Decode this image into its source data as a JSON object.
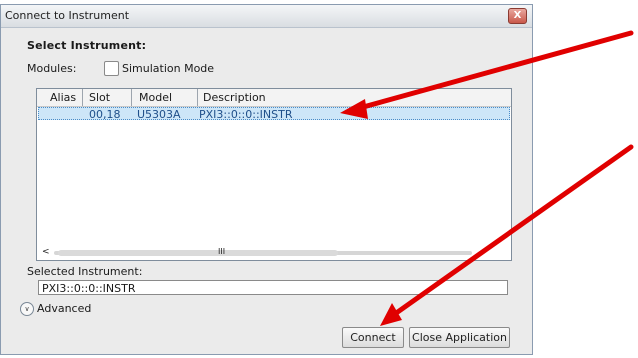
{
  "window": {
    "title": "Connect to Instrument",
    "close_glyph": "X"
  },
  "heading": "Select Instrument:",
  "modules": {
    "label": "Modules:",
    "simulation_label": "Simulation Mode",
    "simulation_checked": false
  },
  "table": {
    "columns": [
      "Alias",
      "Slot",
      "Model",
      "Description"
    ],
    "rows": [
      {
        "alias": "",
        "slot": "00,18",
        "model": "U5303A",
        "description": "PXI3::0::0::INSTR"
      }
    ],
    "scroll_left_glyph": "<",
    "scroll_grip_glyph": "III"
  },
  "selected": {
    "label": "Selected Instrument:",
    "value": "PXI3::0::0::INSTR"
  },
  "advanced": {
    "label": "Advanced",
    "icon": "chevron-down-circle-icon"
  },
  "buttons": {
    "connect": "Connect",
    "close_app": "Close Application"
  },
  "annotation": {
    "color": "#e00000"
  }
}
